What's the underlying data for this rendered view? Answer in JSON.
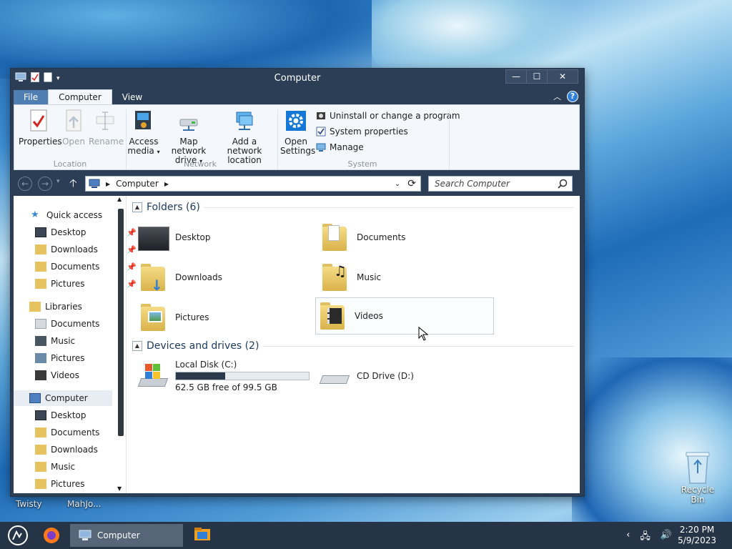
{
  "window": {
    "title": "Computer",
    "controls": {
      "minimize": "—",
      "maximize": "☐",
      "close": "✕"
    }
  },
  "ribbon_tabs": [
    "File",
    "Computer",
    "View"
  ],
  "ribbon": {
    "location_group": "Location",
    "network_group": "Network",
    "system_group": "System",
    "properties": "Properties",
    "open": "Open",
    "rename": "Rename",
    "access_media_1": "Access",
    "access_media_2": "media",
    "map_drive_1": "Map network",
    "map_drive_2": "drive",
    "add_location_1": "Add a network",
    "add_location_2": "location",
    "open_settings_1": "Open",
    "open_settings_2": "Settings",
    "uninstall": "Uninstall or change a program",
    "system_properties": "System properties",
    "manage": "Manage"
  },
  "address": {
    "crumb": "Computer",
    "search_placeholder": "Search Computer"
  },
  "nav": {
    "quick_access": "Quick access",
    "qa_desktop": "Desktop",
    "qa_downloads": "Downloads",
    "qa_documents": "Documents",
    "qa_pictures": "Pictures",
    "libraries": "Libraries",
    "lib_documents": "Documents",
    "lib_music": "Music",
    "lib_pictures": "Pictures",
    "lib_videos": "Videos",
    "computer": "Computer",
    "c_desktop": "Desktop",
    "c_documents": "Documents",
    "c_downloads": "Downloads",
    "c_music": "Music",
    "c_pictures": "Pictures"
  },
  "folders_header": "Folders (6)",
  "folders": {
    "desktop": "Desktop",
    "documents": "Documents",
    "downloads": "Downloads",
    "music": "Music",
    "pictures": "Pictures",
    "videos": "Videos"
  },
  "drives_header": "Devices and drives (2)",
  "drives": {
    "c_name": "Local Disk (C:)",
    "c_free": "62.5 GB free of 99.5 GB",
    "c_used_fraction": 0.372,
    "d_name": "CD Drive (D:)"
  },
  "desktop_icons": {
    "recycle_bin": "Recycle Bin",
    "twisty": "Twisty",
    "mahjong": "MahJo..."
  },
  "taskbar": {
    "active_app": "Computer",
    "time": "2:20 PM",
    "date": "5/9/2023"
  }
}
